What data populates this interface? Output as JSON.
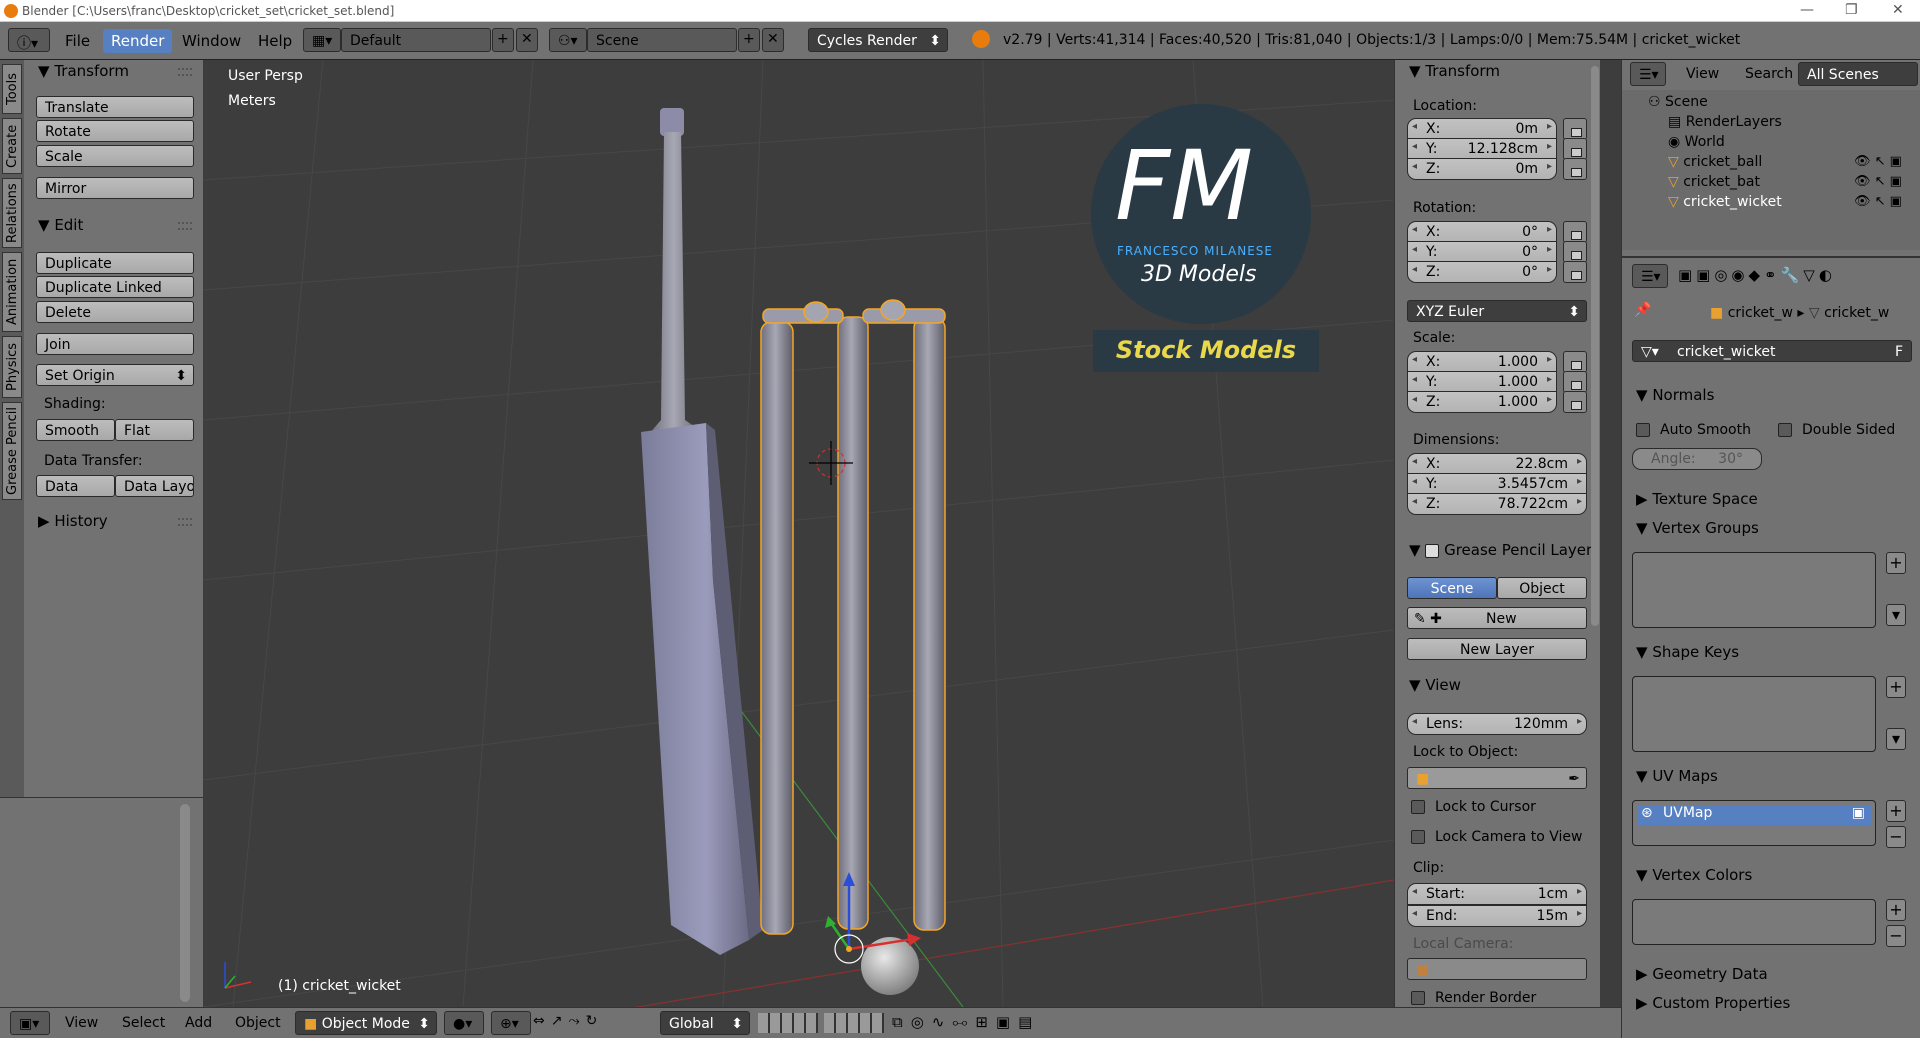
{
  "titlebar": {
    "title": "Blender [C:\\Users\\franc\\Desktop\\cricket_set\\cricket_set.blend]"
  },
  "menubar": {
    "file": "File",
    "render": "Render",
    "window": "Window",
    "help": "Help",
    "layout": "Default",
    "scene": "Scene",
    "engine": "Cycles Render",
    "stats": "v2.79 | Verts:41,314 | Faces:40,520 | Tris:81,040 | Objects:1/3 | Lamps:0/0 | Mem:75.54M | cricket_wicket"
  },
  "tools": {
    "tabs": [
      "Tools",
      "Create",
      "Relations",
      "Animation",
      "Physics",
      "Grease Pencil"
    ],
    "transform_header": "Transform",
    "translate": "Translate",
    "rotate": "Rotate",
    "scale": "Scale",
    "mirror": "Mirror",
    "edit_header": "Edit",
    "duplicate": "Duplicate",
    "duplicate_linked": "Duplicate Linked",
    "delete": "Delete",
    "join": "Join",
    "set_origin": "Set Origin",
    "shading_label": "Shading:",
    "smooth": "Smooth",
    "flat": "Flat",
    "data_transfer_label": "Data Transfer:",
    "data": "Data",
    "data_layo": "Data Layo",
    "history_header": "History"
  },
  "viewport": {
    "persp": "User Persp",
    "units": "Meters",
    "object_name": "(1) cricket_wicket",
    "logo_fm": "FM",
    "logo_sub": "FRANCESCO MILANESE",
    "logo_3d": "3D Models",
    "logo_stock": "Stock Models"
  },
  "nprops": {
    "transform_header": "Transform",
    "location_label": "Location:",
    "loc": [
      {
        "axis": "X:",
        "value": "0m"
      },
      {
        "axis": "Y:",
        "value": "12.128cm"
      },
      {
        "axis": "Z:",
        "value": "0m"
      }
    ],
    "rotation_label": "Rotation:",
    "rot": [
      {
        "axis": "X:",
        "value": "0°"
      },
      {
        "axis": "Y:",
        "value": "0°"
      },
      {
        "axis": "Z:",
        "value": "0°"
      }
    ],
    "rot_mode": "XYZ Euler",
    "scale_label": "Scale:",
    "scale": [
      {
        "axis": "X:",
        "value": "1.000"
      },
      {
        "axis": "Y:",
        "value": "1.000"
      },
      {
        "axis": "Z:",
        "value": "1.000"
      }
    ],
    "dim_label": "Dimensions:",
    "dim": [
      {
        "axis": "X:",
        "value": "22.8cm"
      },
      {
        "axis": "Y:",
        "value": "3.5457cm"
      },
      {
        "axis": "Z:",
        "value": "78.722cm"
      }
    ],
    "gp_header": "Grease Pencil Layer",
    "gp_scene": "Scene",
    "gp_object": "Object",
    "gp_new": "New",
    "gp_new_layer": "New Layer",
    "view_header": "View",
    "lens_label": "Lens:",
    "lens_value": "120mm",
    "lock_obj_label": "Lock to Object:",
    "lock_cursor": "Lock to Cursor",
    "lock_camera": "Lock Camera to View",
    "clip_label": "Clip:",
    "clip_start_label": "Start:",
    "clip_start": "1cm",
    "clip_end_label": "End:",
    "clip_end": "15m",
    "local_camera": "Local Camera:",
    "render_border": "Render Border"
  },
  "outliner": {
    "view": "View",
    "search": "Search",
    "all_scenes": "All Scenes",
    "items": [
      "Scene",
      "RenderLayers",
      "World",
      "cricket_ball",
      "cricket_bat",
      "cricket_wicket"
    ]
  },
  "properties": {
    "crumb1": "cricket_w",
    "crumb2": "cricket_w",
    "mesh_name": "cricket_wicket",
    "f": "F",
    "normals": "Normals",
    "auto_smooth": "Auto Smooth",
    "double_sided": "Double Sided",
    "angle_label": "Angle:",
    "angle_value": "30°",
    "texture_space": "Texture Space",
    "vertex_groups": "Vertex Groups",
    "shape_keys": "Shape Keys",
    "uv_maps": "UV Maps",
    "uvmap": "UVMap",
    "vertex_colors": "Vertex Colors",
    "geometry_data": "Geometry Data",
    "custom_properties": "Custom Properties"
  },
  "bottombar": {
    "view": "View",
    "select": "Select",
    "add": "Add",
    "object": "Object",
    "mode": "Object Mode",
    "orientation": "Global"
  },
  "colors": {
    "accent": "#5680c2",
    "selection": "#f5a623",
    "viewport_bg": "#3d3d3d"
  }
}
